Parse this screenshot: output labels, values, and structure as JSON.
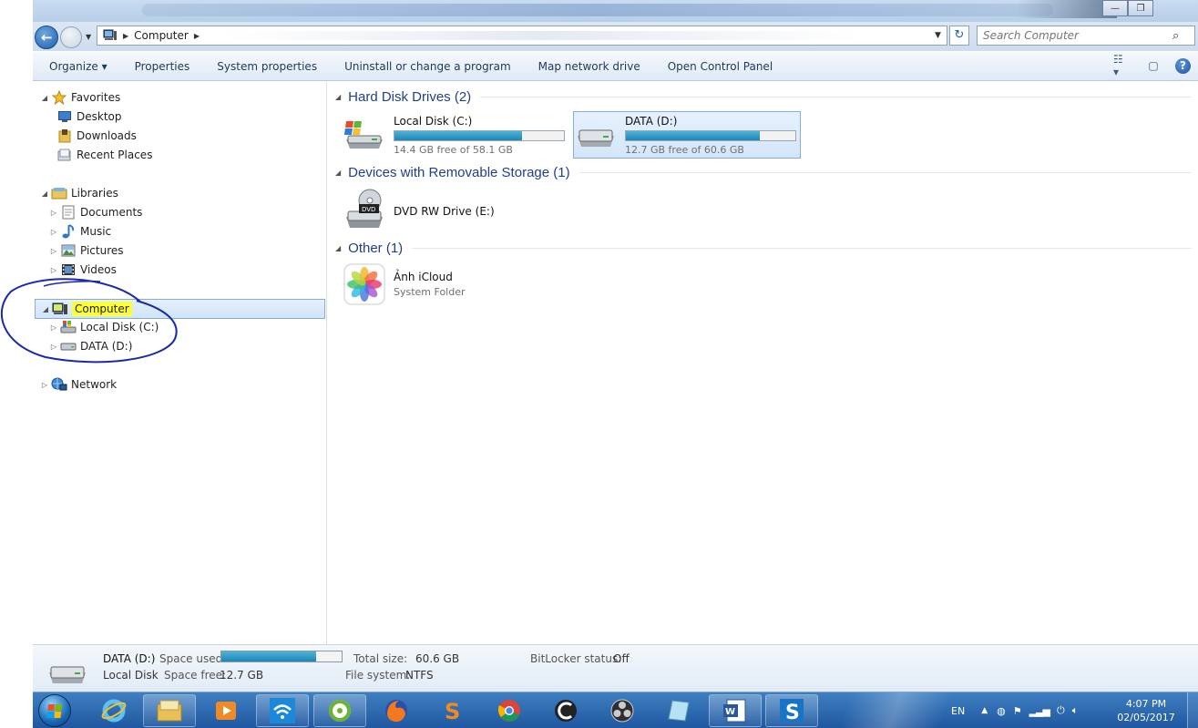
{
  "window": {
    "address_crumb": "Computer",
    "search_placeholder": "Search Computer"
  },
  "toolbar": {
    "items": [
      "Organize",
      "Properties",
      "System properties",
      "Uninstall or change a program",
      "Map network drive",
      "Open Control Panel"
    ]
  },
  "nav": {
    "favorites": "Favorites",
    "desktop": "Desktop",
    "downloads": "Downloads",
    "recent": "Recent Places",
    "libraries": "Libraries",
    "documents": "Documents",
    "music": "Music",
    "pictures": "Pictures",
    "videos": "Videos",
    "computer": "Computer",
    "local_disk": "Local Disk (C:)",
    "data_disk": "DATA (D:)",
    "network": "Network"
  },
  "content": {
    "group_hdd": "Hard Disk Drives (2)",
    "group_removable": "Devices with Removable Storage (1)",
    "group_other": "Other (1)",
    "drive_c": {
      "name": "Local Disk (C:)",
      "free": "14.4 GB free of 58.1 GB",
      "used_fraction": 0.752
    },
    "drive_d": {
      "name": "DATA (D:)",
      "free": "12.7 GB free of 60.6 GB",
      "used_fraction": 0.79
    },
    "dvd": {
      "name": "DVD RW Drive (E:)"
    },
    "icloud": {
      "name": "Ảnh iCloud",
      "type": "System Folder"
    }
  },
  "details": {
    "name": "DATA (D:)",
    "type": "Local Disk",
    "space_used_label": "Space used:",
    "space_used_fraction": 0.79,
    "space_free_label": "Space free:",
    "space_free": "12.7 GB",
    "total_label": "Total size:",
    "total": "60.6 GB",
    "fs_label": "File system:",
    "fs": "NTFS",
    "bitlocker_label": "BitLocker status:",
    "bitlocker": "Off"
  },
  "taskbar": {
    "lang": "EN",
    "time": "4:07 PM",
    "date": "02/05/2017"
  },
  "colors": {
    "selection_border": "#84acdd",
    "bar_fill": "#1f86b5",
    "annotation_ink": "#1a2aa8",
    "highlighter": "#ffff33"
  }
}
